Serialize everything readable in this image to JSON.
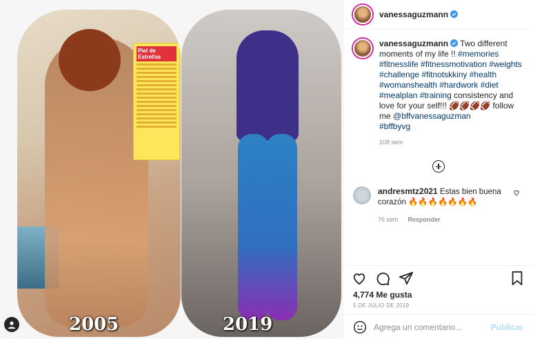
{
  "media": {
    "left_year": "2005",
    "right_year": "2019",
    "magazine_heading": "Piel de Estrellas"
  },
  "header": {
    "username": "vanessaguzmann"
  },
  "caption": {
    "username": "vanessaguzmann",
    "text_plain": " Two different moments of my life !! ",
    "tags": "#memories #fitnesslife #fitnessmotivation #weights #challenge #fitnotskkiny #health #womanshealth #hardwork #diet #mealplan #training",
    "text_end": " consistency and love for your self!!! 🏈🏈🏈🏈 follow me ",
    "mention": "@bffvanessaguzman",
    "hashtag_last": "#bffbyvg",
    "time": "108 sem"
  },
  "comment": {
    "username": "andresmtz2021",
    "text": " Estas bien buena corazón 🔥🔥🔥🔥🔥🔥🔥",
    "time": "76 sem",
    "reply": "Responder"
  },
  "likes": "4,774 Me gusta",
  "date": "5 DE JULIO DE 2019",
  "add_comment": {
    "placeholder": "Agrega un comentario...",
    "publish": "Publicar"
  },
  "colors": {
    "link": "#00376b",
    "verified": "#3897f0",
    "publish_disabled": "#b2dffc"
  }
}
